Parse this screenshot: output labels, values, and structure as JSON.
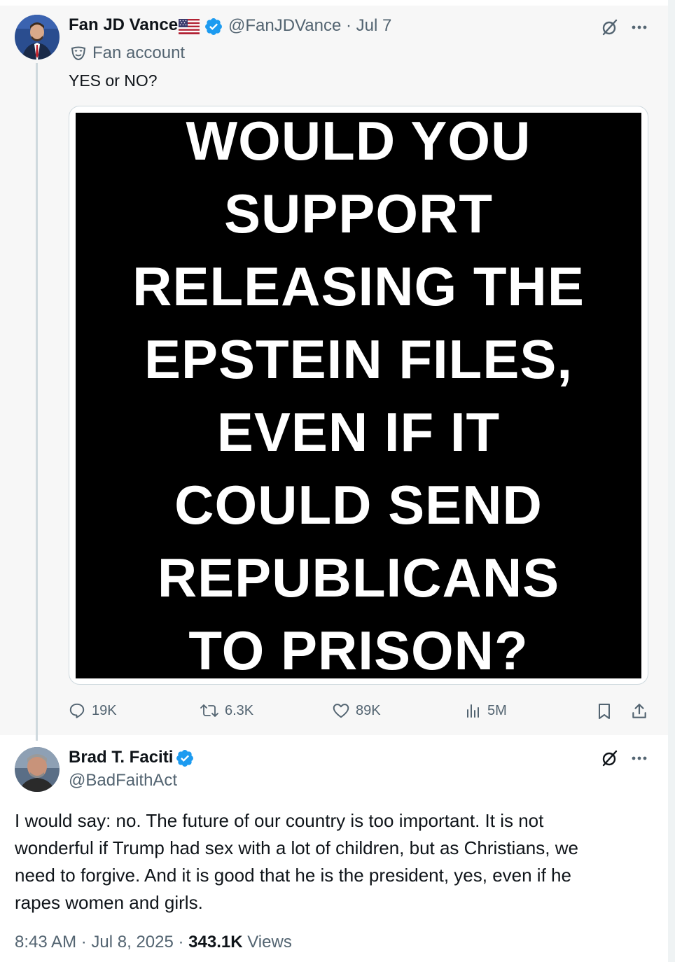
{
  "first_tweet": {
    "display_name": "Fan JD Vance",
    "flag_icon": "us-flag-icon",
    "handle": "@FanJDVance",
    "separator": "·",
    "date": "Jul 7",
    "label_icon": "parody-mask-icon",
    "label_text": "Fan account",
    "text": "YES or NO?",
    "image_lines": [
      "WOULD YOU",
      "SUPPORT",
      "RELEASING THE",
      "EPSTEIN FILES,",
      "EVEN IF IT",
      "COULD SEND",
      "REPUBLICANS",
      "TO PRISON?"
    ],
    "actions": {
      "replies": "19K",
      "reposts": "6.3K",
      "likes": "89K",
      "views": "5M"
    }
  },
  "reply_tweet": {
    "display_name": "Brad T. Faciti",
    "handle": "@BadFaithAct",
    "text_lines": [
      "I would say: no. The future of our country is too important. It is not",
      "wonderful if Trump had sex with a lot of children, but as Christians, we",
      "need to forgive. And it is good that he is the president, yes, even if he",
      "rapes women and girls."
    ],
    "time": "8:43 AM",
    "separator": "·",
    "date": "Jul 8, 2025",
    "views_count": "343.1K",
    "views_label": "Views"
  },
  "colors": {
    "verified_blue": "#1d9bf0",
    "muted_text": "#536471",
    "main_text": "#0f1419"
  }
}
